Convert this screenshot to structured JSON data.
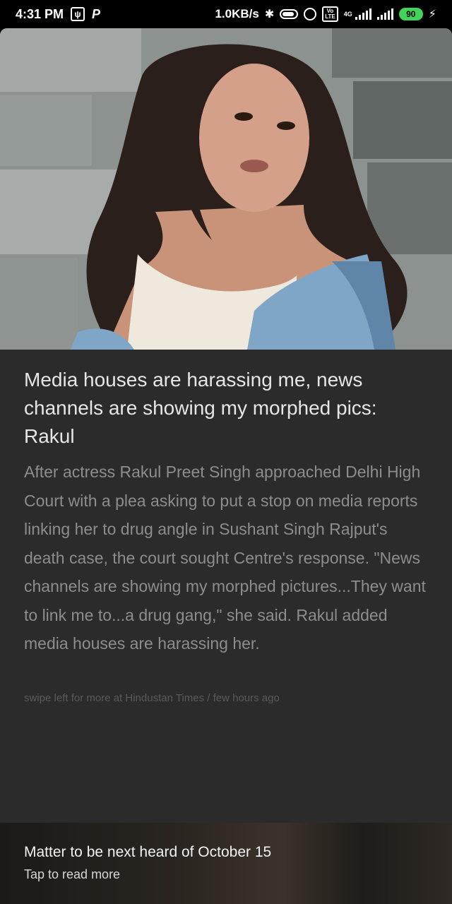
{
  "status_bar": {
    "time": "4:31 PM",
    "speed": "1.0KB/s",
    "volte": "Vo LTE",
    "net_type": "4G",
    "battery": "90",
    "icons": [
      "usb-icon",
      "p-icon",
      "bluetooth-icon",
      "toggle-icon",
      "alarm-icon",
      "volte-icon",
      "signal-icon",
      "signal-icon-2",
      "battery-icon",
      "charging-icon"
    ]
  },
  "article": {
    "headline": "Media houses are harassing me, news channels are showing my morphed pics: Rakul",
    "body": "After actress Rakul Preet Singh approached Delhi High Court with a plea asking to put a stop on media reports linking her to drug angle in Sushant Singh Rajput's death case, the court sought Centre's response. \"News channels are showing my morphed pictures...They want to link me to...a drug gang,\" she said. Rakul added media houses are harassing her.",
    "source_line": "swipe left for more at Hindustan Times / few hours ago"
  },
  "banner": {
    "title": "Matter to be next heard of October 15",
    "subtitle": "Tap to read more"
  },
  "colors": {
    "card_bg": "#2b2b2b",
    "headline": "#e6e6e6",
    "body": "#8d8d8d",
    "battery": "#42d35a"
  }
}
